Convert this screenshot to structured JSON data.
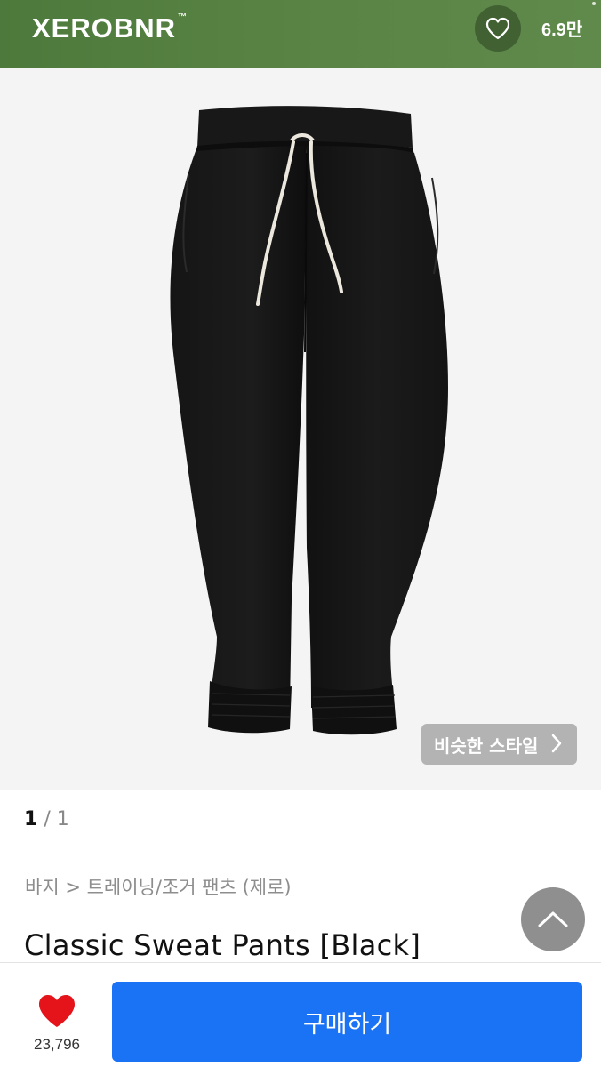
{
  "header": {
    "brand": "XEROBNR",
    "brand_mark": "™",
    "like_count": "6.9만",
    "bg_color": "#5a8446"
  },
  "hero": {
    "similar_style_label": "비슷한 스타일",
    "image_alt": "black sweat pants with white drawstring"
  },
  "pager": {
    "current": "1",
    "separator": "/",
    "total": "1"
  },
  "breadcrumb": "바지 > 트레이닝/조거 팬츠 (제로)",
  "product": {
    "title": "Classic Sweat Pants [Black]"
  },
  "bottom": {
    "wish_count": "23,796",
    "buy_label": "구매하기",
    "buy_color": "#1a73f5",
    "heart_color": "#e5141b"
  },
  "icons": {
    "header_heart": "heart-outline-icon",
    "chevron": "chevron-right-icon",
    "scroll_up": "chevron-up-icon",
    "wish": "heart-filled-icon"
  }
}
